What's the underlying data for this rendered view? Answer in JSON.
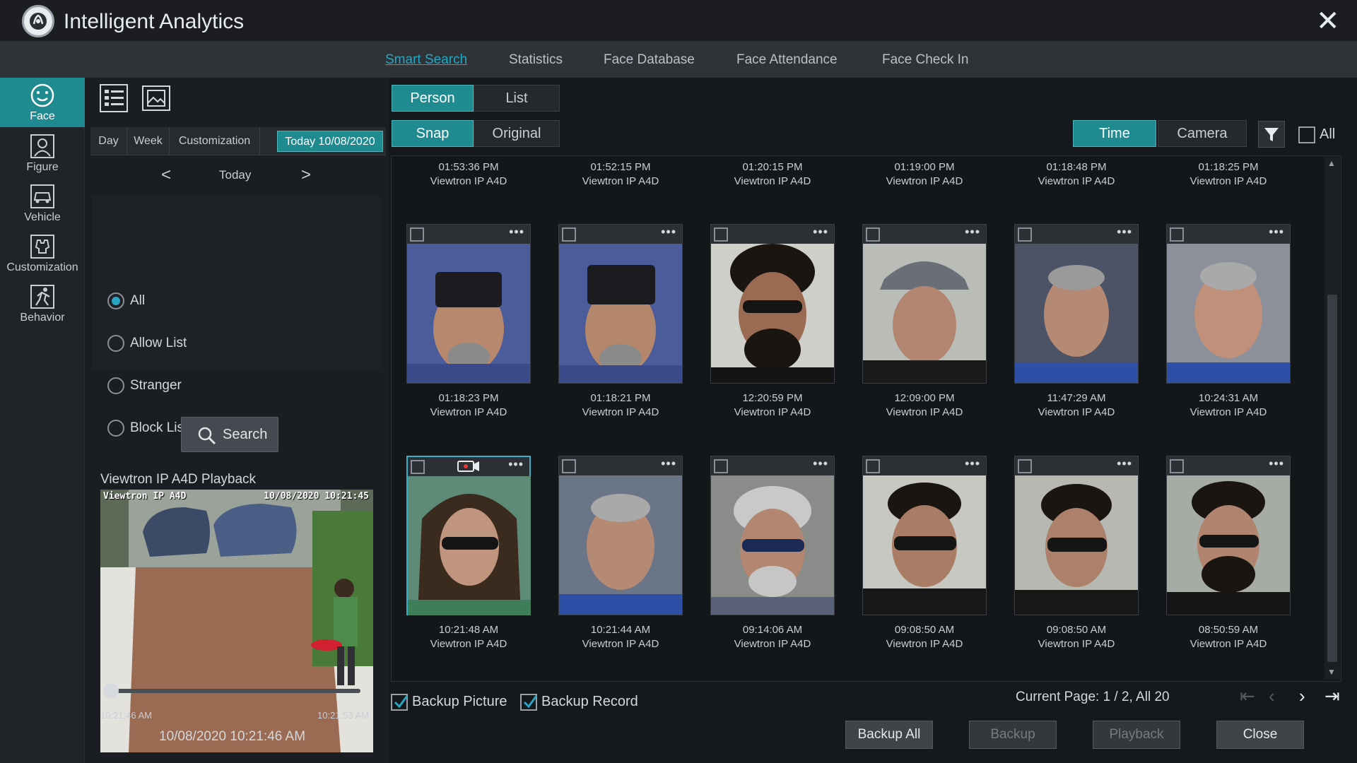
{
  "window": {
    "title": "Intelligent Analytics",
    "close_glyph": "✕"
  },
  "tabs": [
    {
      "label": "Smart Search",
      "active": true
    },
    {
      "label": "Statistics"
    },
    {
      "label": "Face Database"
    },
    {
      "label": "Face Attendance"
    },
    {
      "label": "Face Check In"
    }
  ],
  "sidenav": [
    {
      "label": "Face",
      "icon": "face-icon",
      "active": true
    },
    {
      "label": "Figure",
      "icon": "figure-icon"
    },
    {
      "label": "Vehicle",
      "icon": "vehicle-icon"
    },
    {
      "label": "Customization",
      "icon": "customization-icon"
    },
    {
      "label": "Behavior",
      "icon": "behavior-icon"
    }
  ],
  "left": {
    "view_icons": [
      "list-view-icon",
      "image-view-icon"
    ],
    "periods": [
      "Day",
      "Week",
      "Customization",
      "Today 10/08/2020"
    ],
    "active_period": "Today 10/08/2020",
    "prev_glyph": "<",
    "next_glyph": ">",
    "today_label": "Today",
    "filter_options": [
      "All",
      "Allow List",
      "Stranger",
      "Block List"
    ],
    "selected_filter": "All",
    "search_label": "Search"
  },
  "playback": {
    "title": "Viewtron IP A4D Playback",
    "osd_camera": "Viewtron IP A4D",
    "osd_time": "10/08/2020 10:21:45",
    "start_time": "10:21:46 AM",
    "end_time": "10:21:53 AM",
    "position_fraction": 0.0,
    "current_datetime": "10/08/2020 10:21:46 AM"
  },
  "mode_toggle": [
    {
      "label": "Person",
      "active": true
    },
    {
      "label": "List"
    }
  ],
  "image_toggle": [
    {
      "label": "Snap",
      "active": true
    },
    {
      "label": "Original"
    }
  ],
  "sort_toggle": [
    {
      "label": "Time",
      "active": true
    },
    {
      "label": "Camera"
    }
  ],
  "all_label": "All",
  "top_row": [
    {
      "time": "01:53:36 PM",
      "camera": "Viewtron IP A4D"
    },
    {
      "time": "01:52:15 PM",
      "camera": "Viewtron IP A4D"
    },
    {
      "time": "01:20:15 PM",
      "camera": "Viewtron IP A4D"
    },
    {
      "time": "01:19:00 PM",
      "camera": "Viewtron IP A4D"
    },
    {
      "time": "01:18:48 PM",
      "camera": "Viewtron IP A4D"
    },
    {
      "time": "01:18:25 PM",
      "camera": "Viewtron IP A4D"
    }
  ],
  "row1": [
    {
      "time": "01:18:23 PM",
      "camera": "Viewtron IP A4D"
    },
    {
      "time": "01:18:21 PM",
      "camera": "Viewtron IP A4D"
    },
    {
      "time": "12:20:59 PM",
      "camera": "Viewtron IP A4D"
    },
    {
      "time": "12:09:00 PM",
      "camera": "Viewtron IP A4D"
    },
    {
      "time": "11:47:29 AM",
      "camera": "Viewtron IP A4D"
    },
    {
      "time": "10:24:31 AM",
      "camera": "Viewtron IP A4D"
    }
  ],
  "row2": [
    {
      "time": "10:21:48 AM",
      "camera": "Viewtron IP A4D",
      "selected": true
    },
    {
      "time": "10:21:44 AM",
      "camera": "Viewtron IP A4D"
    },
    {
      "time": "09:14:06 AM",
      "camera": "Viewtron IP A4D"
    },
    {
      "time": "09:08:50 AM",
      "camera": "Viewtron IP A4D"
    },
    {
      "time": "09:08:50 AM",
      "camera": "Viewtron IP A4D"
    },
    {
      "time": "08:50:59 AM",
      "camera": "Viewtron IP A4D"
    }
  ],
  "options": {
    "backup_picture": "Backup Picture",
    "backup_record": "Backup Record"
  },
  "pagination": {
    "current_page": 1,
    "total_pages": 2,
    "total_items": 20,
    "text": "Current Page: 1 / 2, All 20"
  },
  "buttons": {
    "backup_all": "Backup All",
    "backup": "Backup",
    "playback": "Playback",
    "close": "Close"
  },
  "colors": {
    "accent": "#1f8b90",
    "active_tab": "#22a8c7",
    "selection": "#36b0c8"
  }
}
